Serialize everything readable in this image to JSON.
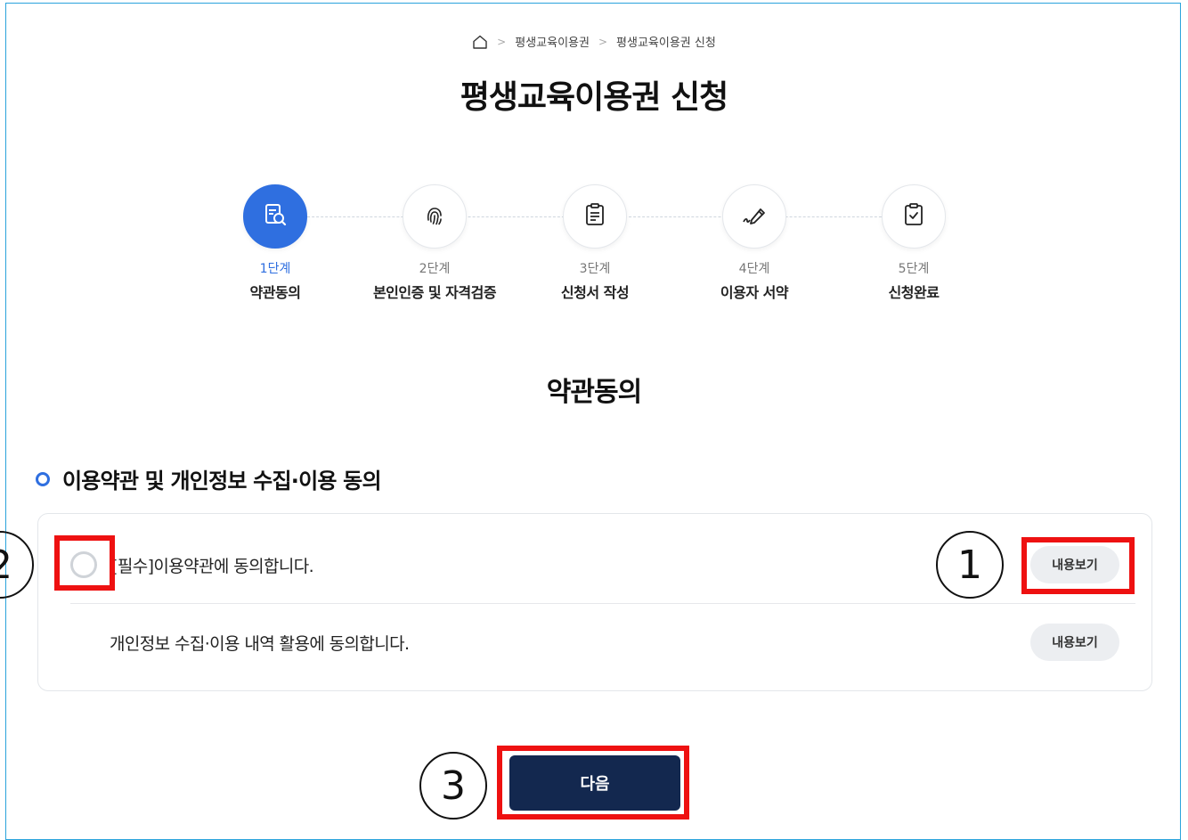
{
  "breadcrumb": {
    "items": [
      "평생교육이용권",
      "평생교육이용권 신청"
    ]
  },
  "title": "평생교육이용권 신청",
  "steps": [
    {
      "num": "1단계",
      "name": "약관동의",
      "icon": "document-search-icon",
      "active": true
    },
    {
      "num": "2단계",
      "name": "본인인증 및 자격검증",
      "icon": "fingerprint-icon",
      "active": false
    },
    {
      "num": "3단계",
      "name": "신청서 작성",
      "icon": "clipboard-form-icon",
      "active": false
    },
    {
      "num": "4단계",
      "name": "이용자 서약",
      "icon": "pen-sign-icon",
      "active": false
    },
    {
      "num": "5단계",
      "name": "신청완료",
      "icon": "clipboard-check-icon",
      "active": false
    }
  ],
  "section_title": "약관동의",
  "agreement": {
    "heading": "이용약관 및 개인정보 수집·이용 동의",
    "items": [
      {
        "text": "[필수]이용약관에 동의합니다.",
        "view_label": "내용보기"
      },
      {
        "text": "개인정보 수집·이용 내역 활용에 동의합니다.",
        "view_label": "내용보기"
      }
    ]
  },
  "next_label": "다음",
  "annotations": {
    "m1": "1",
    "m2": "2",
    "m3": "3"
  },
  "colors": {
    "accent": "#2f6fe0",
    "primary_button": "#13284f",
    "highlight": "#ee1111"
  }
}
